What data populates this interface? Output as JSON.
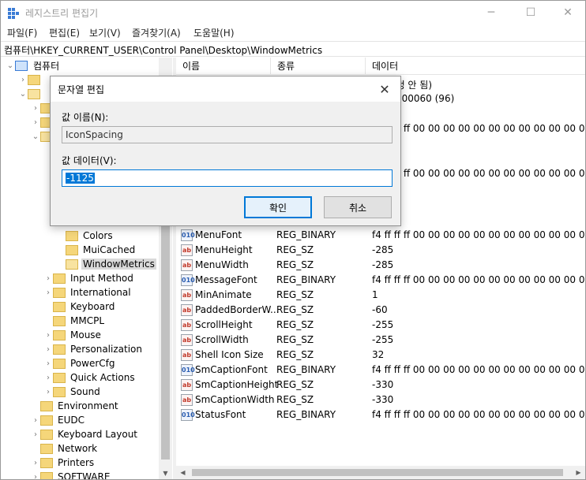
{
  "window": {
    "title": "레지스트리 편집기",
    "minimize": "─",
    "maximize": "☐",
    "close": "✕"
  },
  "menu": [
    "파일(F)",
    "편집(E)",
    "보기(V)",
    "즐겨찾기(A)",
    "도움말(H)"
  ],
  "address": "컴퓨터\\HKEY_CURRENT_USER\\Control Panel\\Desktop\\WindowMetrics",
  "tree": {
    "root": "컴퓨터",
    "items": [
      {
        "label": "Colors",
        "selected": false
      },
      {
        "label": "MuiCached",
        "selected": false
      },
      {
        "label": "WindowMetrics",
        "selected": true
      },
      {
        "label": "Input Method",
        "selected": false
      },
      {
        "label": "International",
        "selected": false
      },
      {
        "label": "Keyboard",
        "selected": false
      },
      {
        "label": "MMCPL",
        "selected": false
      },
      {
        "label": "Mouse",
        "selected": false
      },
      {
        "label": "Personalization",
        "selected": false
      },
      {
        "label": "PowerCfg",
        "selected": false
      },
      {
        "label": "Quick Actions",
        "selected": false
      },
      {
        "label": "Sound",
        "selected": false
      },
      {
        "label": "Environment",
        "selected": false
      },
      {
        "label": "EUDC",
        "selected": false
      },
      {
        "label": "Keyboard Layout",
        "selected": false
      },
      {
        "label": "Network",
        "selected": false
      },
      {
        "label": "Printers",
        "selected": false
      },
      {
        "label": "SOFTWARE",
        "selected": false
      }
    ]
  },
  "list": {
    "columns": [
      "이름",
      "종류",
      "데이터"
    ],
    "partial_top": [
      "(값 설정 안 됨)",
      "0x00000060 (96)"
    ],
    "hex_value": "f4 ff ff ff 00 00 00 00 00 00 00 00 00 00 00 00 00",
    "rows": [
      {
        "name": "MenuFont",
        "type": "REG_BINARY",
        "data": "f4 ff ff ff 00 00 00 00 00 00 00 00 00 00 00 00 00",
        "icon": "bin"
      },
      {
        "name": "MenuHeight",
        "type": "REG_SZ",
        "data": "-285",
        "icon": "sz"
      },
      {
        "name": "MenuWidth",
        "type": "REG_SZ",
        "data": "-285",
        "icon": "sz"
      },
      {
        "name": "MessageFont",
        "type": "REG_BINARY",
        "data": "f4 ff ff ff 00 00 00 00 00 00 00 00 00 00 00 00 00",
        "icon": "bin"
      },
      {
        "name": "MinAnimate",
        "type": "REG_SZ",
        "data": "1",
        "icon": "sz"
      },
      {
        "name": "PaddedBorderW...",
        "type": "REG_SZ",
        "data": "-60",
        "icon": "sz"
      },
      {
        "name": "ScrollHeight",
        "type": "REG_SZ",
        "data": "-255",
        "icon": "sz"
      },
      {
        "name": "ScrollWidth",
        "type": "REG_SZ",
        "data": "-255",
        "icon": "sz"
      },
      {
        "name": "Shell Icon Size",
        "type": "REG_SZ",
        "data": "32",
        "icon": "sz"
      },
      {
        "name": "SmCaptionFont",
        "type": "REG_BINARY",
        "data": "f4 ff ff ff 00 00 00 00 00 00 00 00 00 00 00 00 00",
        "icon": "bin"
      },
      {
        "name": "SmCaptionHeight",
        "type": "REG_SZ",
        "data": "-330",
        "icon": "sz"
      },
      {
        "name": "SmCaptionWidth",
        "type": "REG_SZ",
        "data": "-330",
        "icon": "sz"
      },
      {
        "name": "StatusFont",
        "type": "REG_BINARY",
        "data": "f4 ff ff ff 00 00 00 00 00 00 00 00 00 00 00 00 00",
        "icon": "bin"
      }
    ]
  },
  "dialog": {
    "title": "문자열 편집",
    "close": "✕",
    "name_label": "값 이름(N):",
    "name_value": "IconSpacing",
    "data_label": "값 데이터(V):",
    "data_value": "-1125",
    "ok_label": "확인",
    "cancel_label": "취소"
  },
  "colors": {
    "accent": "#0078d7",
    "selection": "#d9d9d9"
  }
}
